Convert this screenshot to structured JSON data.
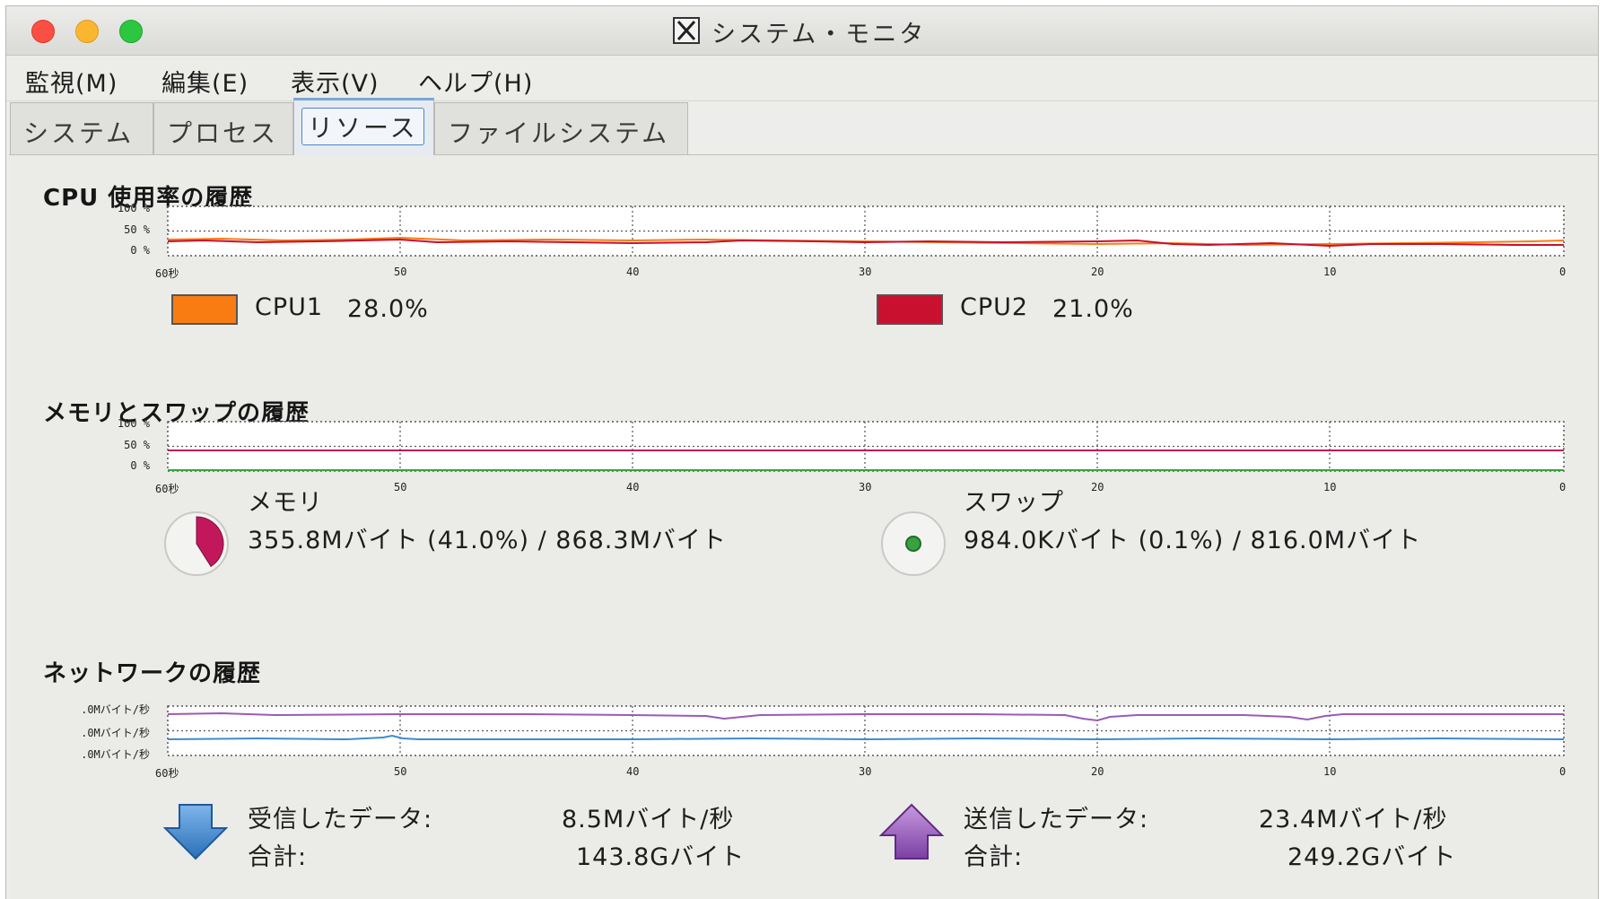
{
  "window": {
    "title": "システム・モニタ"
  },
  "menu": [
    "監視(M)",
    "編集(E)",
    "表示(V)",
    "ヘルプ(H)"
  ],
  "tabs": [
    "システム",
    "プロセス",
    "リソース",
    "ファイルシステム"
  ],
  "active_tab": "リソース",
  "cpu": {
    "section_title": "CPU 使用率の履歴",
    "y_ticks": [
      "100 %",
      "50 %",
      "0 %"
    ],
    "x_ticks": [
      "60秒",
      "50",
      "40",
      "30",
      "20",
      "10",
      "0"
    ],
    "legend": [
      {
        "label": "CPU1",
        "value": "28.0%",
        "color": "#f97c13"
      },
      {
        "label": "CPU2",
        "value": "21.0%",
        "color": "#c9102e"
      }
    ]
  },
  "memory": {
    "section_title": "メモリとスワップの履歴",
    "y_ticks": [
      "100 %",
      "50 %",
      "0 %"
    ],
    "x_ticks": [
      "60秒",
      "50",
      "40",
      "30",
      "20",
      "10",
      "0"
    ],
    "memory_label": "メモリ",
    "memory_value": "355.8Mバイト (41.0%) / 868.3Mバイト",
    "memory_fraction": 0.41,
    "memory_color": "#c2185b",
    "swap_label": "スワップ",
    "swap_value": "984.0Kバイト (0.1%) / 816.0Mバイト",
    "swap_fraction": 0.001,
    "swap_color": "#3aa042"
  },
  "network": {
    "section_title": "ネットワークの履歴",
    "y_ticks": [
      ".0Mバイト/秒",
      ".0Mバイト/秒",
      ".0Mバイト/秒"
    ],
    "x_ticks": [
      "60秒",
      "50",
      "40",
      "30",
      "20",
      "10",
      "0"
    ],
    "received_label": "受信したデータ:",
    "received_value": "8.5Mバイト/秒",
    "received_total_label": "合計:",
    "received_total_value": "143.8Gバイト",
    "sent_label": "送信したデータ:",
    "sent_value": "23.4Mバイト/秒",
    "sent_total_label": "合計:",
    "sent_total_value": "249.2Gバイト",
    "received_color": "#3d8bd0",
    "sent_color": "#9b5bb5"
  }
}
